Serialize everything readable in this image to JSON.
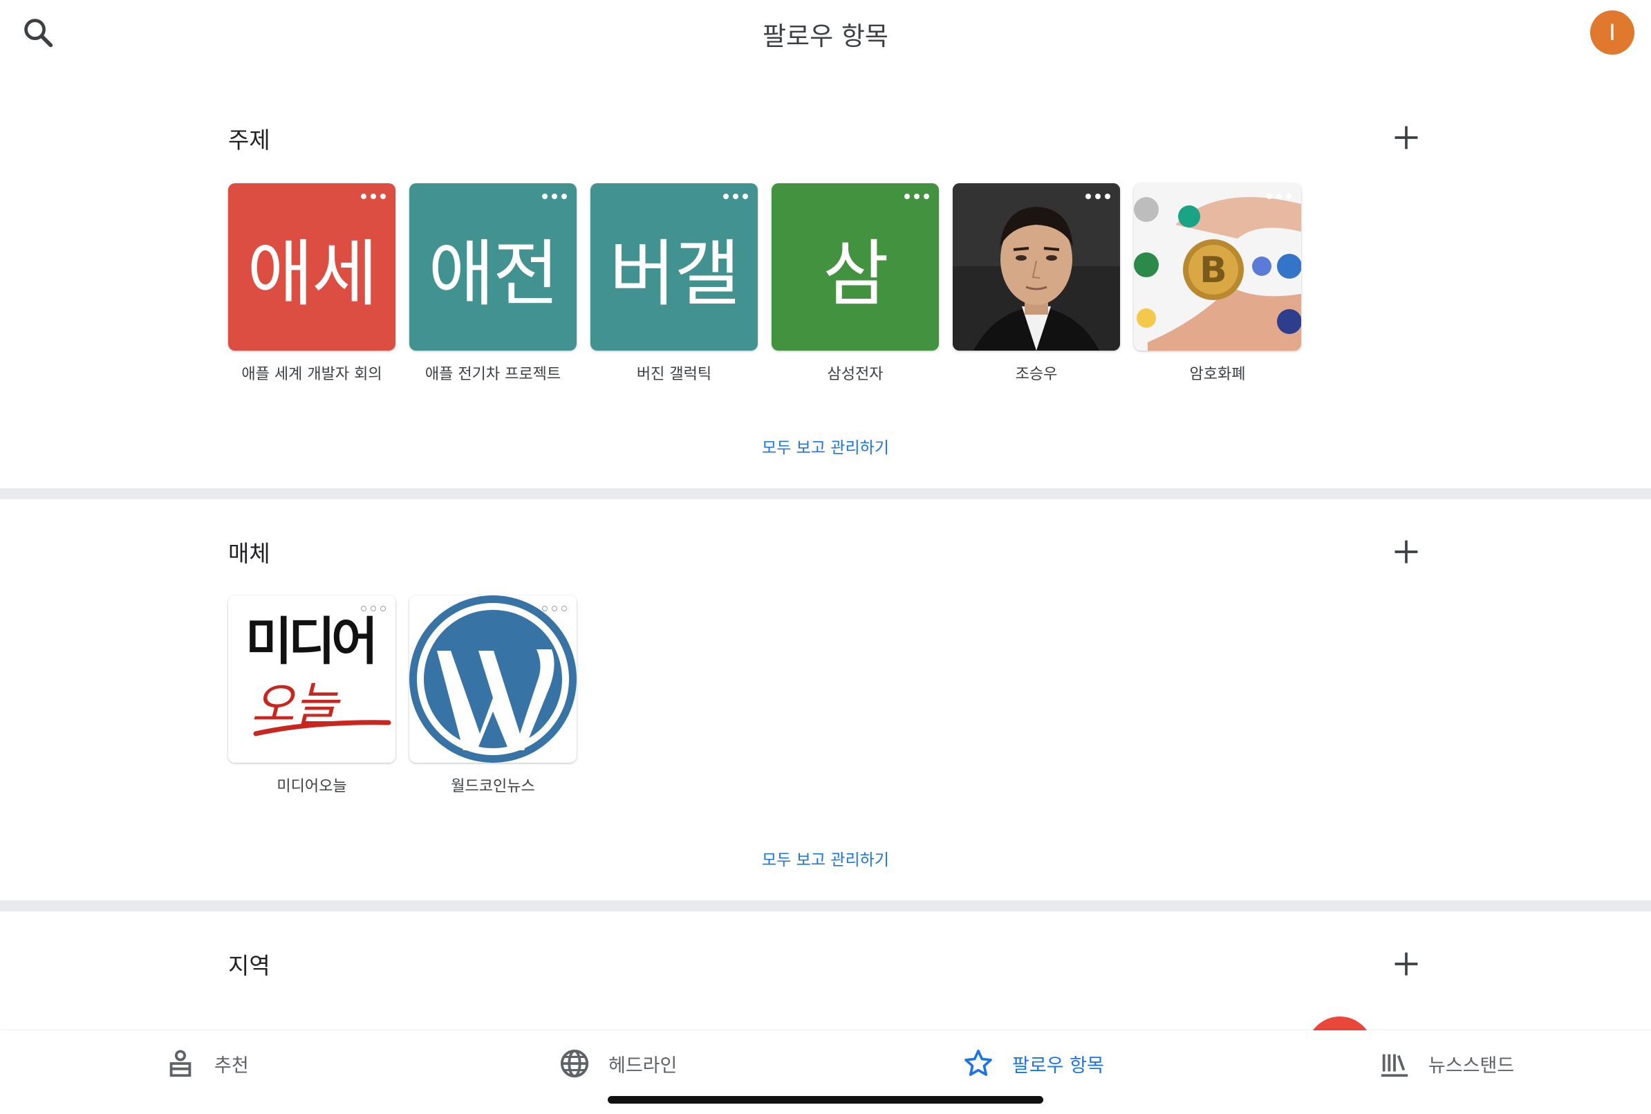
{
  "header": {
    "title": "팔로우 항목",
    "avatar_letter": "I",
    "avatar_color": "#e0792e"
  },
  "topics": {
    "title": "주제",
    "see_all": "모두 보고 관리하기",
    "items": [
      {
        "abbr": "애세",
        "label": "애플 세계 개발자 회의",
        "color": "#dc4e41"
      },
      {
        "abbr": "애전",
        "label": "애플 전기차 프로젝트",
        "color": "#429292"
      },
      {
        "abbr": "버갤",
        "label": "버진 갤럭틱",
        "color": "#429292"
      },
      {
        "abbr": "삼",
        "label": "삼성전자",
        "color": "#43923f"
      },
      {
        "abbr": "",
        "label": "조승우",
        "image": "portrait-photo"
      },
      {
        "abbr": "",
        "label": "암호화폐",
        "image": "crypto-coins-photo"
      }
    ]
  },
  "sources": {
    "title": "매체",
    "see_all": "모두 보고 관리하기",
    "items": [
      {
        "label": "미디어오늘",
        "logo_text_top": "미디어",
        "logo_text_bottom": "오늘",
        "image": "mediatoday-logo"
      },
      {
        "label": "월드코인뉴스",
        "image": "wordpress-logo"
      }
    ]
  },
  "regions": {
    "title": "지역"
  },
  "bottom_nav": {
    "items": [
      {
        "label": "추천",
        "icon": "for-you-icon"
      },
      {
        "label": "헤드라인",
        "icon": "globe-icon"
      },
      {
        "label": "팔로우 항목",
        "icon": "star-icon",
        "active": true
      },
      {
        "label": "뉴스스탠드",
        "icon": "newsstand-icon"
      }
    ]
  },
  "colors": {
    "accent": "#1a73e8",
    "divider": "#e8eaed"
  }
}
